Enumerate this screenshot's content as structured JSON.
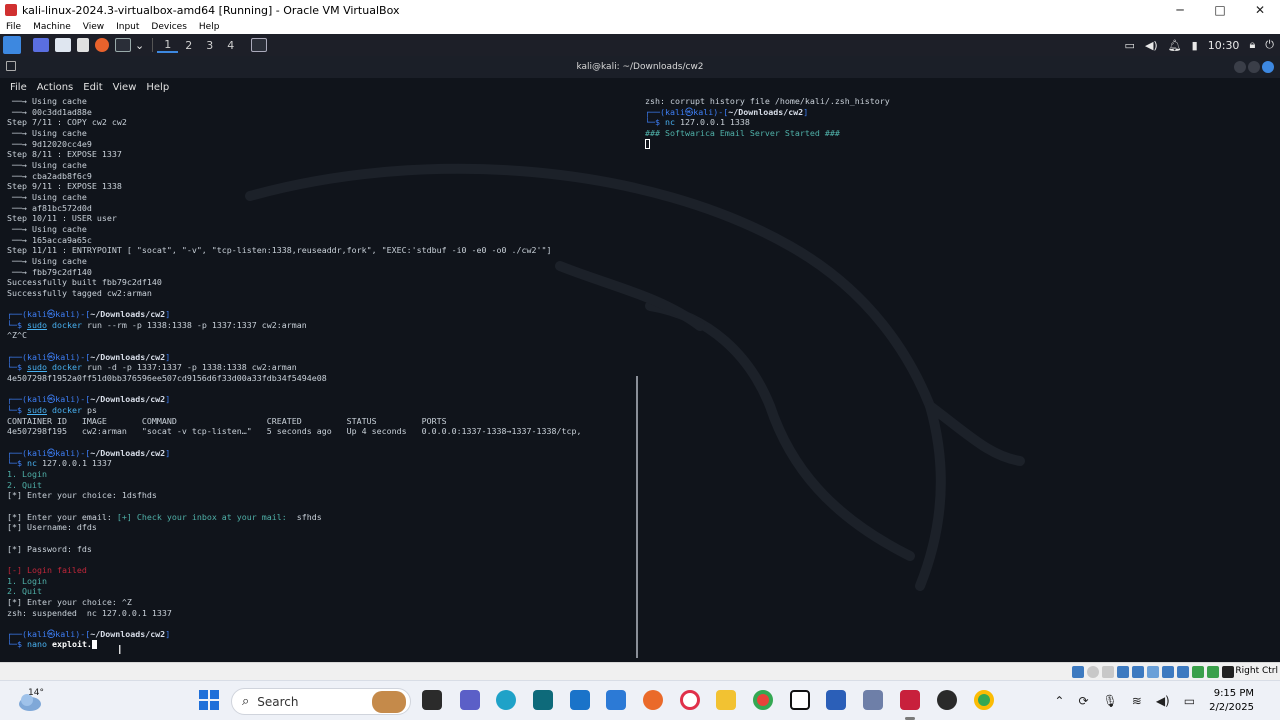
{
  "vbox": {
    "title": "kali-linux-2024.3-virtualbox-amd64 [Running] - Oracle VM VirtualBox",
    "menu": [
      "File",
      "Machine",
      "View",
      "Input",
      "Devices",
      "Help"
    ],
    "controls": {
      "minimize": "─",
      "maximize": "□",
      "close": "✕"
    },
    "status_hostkey": "Right Ctrl"
  },
  "kali_panel": {
    "workspaces": [
      "1",
      "2",
      "3",
      "4"
    ],
    "active_workspace": "1",
    "time": "10:30",
    "icons": [
      "kali-menu-icon",
      "desktop-icon",
      "file-manager-icon",
      "text-editor-icon",
      "firefox-icon",
      "terminal-icon",
      "chevron-down-icon",
      "active-window-icon"
    ]
  },
  "terminal": {
    "title": "kali@kali: ~/Downloads/cw2",
    "menu": [
      "File",
      "Actions",
      "Edit",
      "View",
      "Help"
    ],
    "left_lines": [
      {
        "t": "plain",
        "text": " ──→ Using cache"
      },
      {
        "t": "plain",
        "text": " ──→ 00c3dd1ad88e"
      },
      {
        "t": "plain",
        "text": "Step 7/11 : COPY cw2 cw2"
      },
      {
        "t": "plain",
        "text": " ──→ Using cache"
      },
      {
        "t": "plain",
        "text": " ──→ 9d12020cc4e9"
      },
      {
        "t": "plain",
        "text": "Step 8/11 : EXPOSE 1337"
      },
      {
        "t": "plain",
        "text": " ──→ Using cache"
      },
      {
        "t": "plain",
        "text": " ──→ cba2adb8f6c9"
      },
      {
        "t": "plain",
        "text": "Step 9/11 : EXPOSE 1338"
      },
      {
        "t": "plain",
        "text": " ──→ Using cache"
      },
      {
        "t": "plain",
        "text": " ──→ af81bc572d0d"
      },
      {
        "t": "plain",
        "text": "Step 10/11 : USER user"
      },
      {
        "t": "plain",
        "text": " ──→ Using cache"
      },
      {
        "t": "plain",
        "text": " ──→ 165acca9a65c"
      },
      {
        "t": "plain",
        "text": "Step 11/11 : ENTRYPOINT [ \"socat\", \"-v\", \"tcp-listen:1338,reuseaddr,fork\", \"EXEC:'stdbuf -i0 -e0 -o0 ./cw2'\"]"
      },
      {
        "t": "plain",
        "text": " ──→ Using cache"
      },
      {
        "t": "plain",
        "text": " ──→ fbb79c2df140"
      },
      {
        "t": "plain",
        "text": "Successfully built fbb79c2df140"
      },
      {
        "t": "plain",
        "text": "Successfully tagged cw2:arman"
      },
      {
        "t": "blank",
        "text": ""
      },
      {
        "t": "prompt",
        "text": "~/Downloads/cw2"
      },
      {
        "t": "cmd",
        "sudo": "sudo",
        "bin": "docker",
        "args": " run --rm -p 1338:1338 -p 1337:1337 cw2:arman"
      },
      {
        "t": "plain",
        "text": "^Z^C"
      },
      {
        "t": "blank",
        "text": ""
      },
      {
        "t": "prompt",
        "text": "~/Downloads/cw2"
      },
      {
        "t": "cmd",
        "sudo": "sudo",
        "bin": "docker",
        "args": " run -d -p 1337:1337 -p 1338:1338 cw2:arman"
      },
      {
        "t": "plain",
        "text": "4e507298f1952a0ff51d0bb376596ee507cd9156d6f33d00a33fdb34f5494e08"
      },
      {
        "t": "blank",
        "text": ""
      },
      {
        "t": "prompt",
        "text": "~/Downloads/cw2"
      },
      {
        "t": "cmd",
        "sudo": "sudo",
        "bin": "docker",
        "args": " ps"
      },
      {
        "t": "plain",
        "text": "CONTAINER ID   IMAGE       COMMAND                  CREATED         STATUS         PORTS"
      },
      {
        "t": "plain",
        "text": "4e507298f195   cw2:arman   \"socat -v tcp-listen…\"   5 seconds ago   Up 4 seconds   0.0.0.0:1337-1338→1337-1338/tcp,"
      },
      {
        "t": "blank",
        "text": ""
      },
      {
        "t": "prompt",
        "text": "~/Downloads/cw2"
      },
      {
        "t": "cmd",
        "sudo": "",
        "bin": "nc",
        "args": " 127.0.0.1 1337"
      },
      {
        "t": "menu",
        "text": "1. Login"
      },
      {
        "t": "menu",
        "text": "2. Quit"
      },
      {
        "t": "plain",
        "text": "[*] Enter your choice: 1dsfhds"
      },
      {
        "t": "blank",
        "text": ""
      },
      {
        "t": "email",
        "pre": "[*] Enter your email: ",
        "mid": "[+] Check your inbox at your mail:",
        "post": "  sfhds"
      },
      {
        "t": "plain",
        "text": "[*] Username: dfds"
      },
      {
        "t": "blank",
        "text": ""
      },
      {
        "t": "plain",
        "text": "[*] Password: fds"
      },
      {
        "t": "blank",
        "text": ""
      },
      {
        "t": "red",
        "text": "[-] Login failed"
      },
      {
        "t": "menu",
        "text": "1. Login"
      },
      {
        "t": "menu",
        "text": "2. Quit"
      },
      {
        "t": "plain",
        "text": "[*] Enter your choice: ^Z"
      },
      {
        "t": "plain",
        "text": "zsh: suspended  nc 127.0.0.1 1337"
      },
      {
        "t": "blank",
        "text": ""
      },
      {
        "t": "prompt",
        "text": "~/Downloads/cw2"
      },
      {
        "t": "nano",
        "bin": "nano",
        "file": "exploit."
      }
    ],
    "prompt_user": "(kali㉿kali)",
    "right_lines": [
      {
        "t": "plain",
        "text": "zsh: corrupt history file /home/kali/.zsh_history"
      },
      {
        "t": "prompt",
        "text": "~/Downloads/cw2"
      },
      {
        "t": "cmd",
        "sudo": "",
        "bin": "nc",
        "args": " 127.0.0.1 1338"
      },
      {
        "t": "cyan",
        "text": "### Softwarica Email Server Started ###"
      },
      {
        "t": "cursor",
        "text": ""
      }
    ]
  },
  "taskbar": {
    "weather": "14°",
    "search_placeholder": "Search",
    "time": "9:15 PM",
    "date": "2/2/2025",
    "apps": [
      "file-explorer-icon",
      "teams-icon",
      "edge-icon",
      "terminal-app-icon",
      "mail-icon",
      "store-icon",
      "firefox-icon",
      "opera-icon",
      "folder-icon",
      "chrome-icon",
      "notion-icon",
      "word-icon",
      "virtualbox-icon",
      "kali-vm-icon",
      "obs-icon",
      "chrome-alt-icon"
    ]
  }
}
